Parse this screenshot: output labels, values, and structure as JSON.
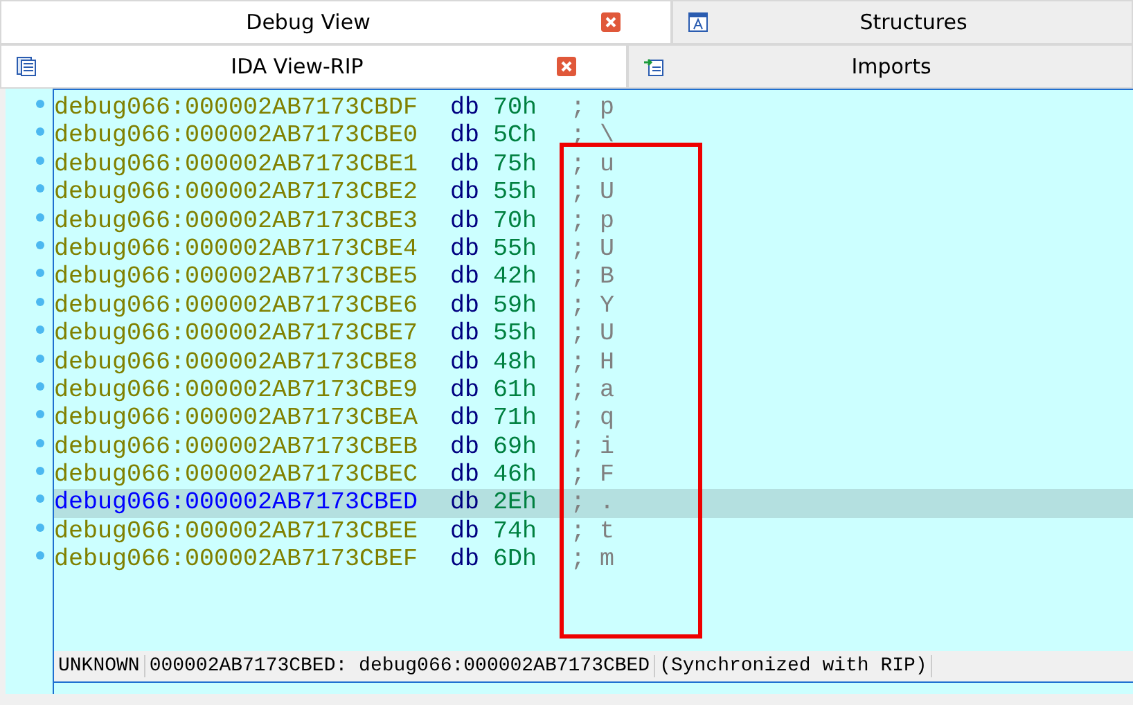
{
  "tab_rows": [
    {
      "tabs": [
        {
          "label": "Debug View",
          "selected": true,
          "closable": true
        },
        {
          "label": "Structures",
          "selected": false,
          "closable": false
        }
      ]
    },
    {
      "tabs": [
        {
          "label": "IDA View-RIP",
          "selected": true,
          "closable": true
        },
        {
          "label": "Imports",
          "selected": false,
          "closable": false
        }
      ]
    }
  ],
  "listing": [
    {
      "address": "debug066:000002AB7173CBDF",
      "directive": "db",
      "value": "70h",
      "comment": "; p",
      "selected": false
    },
    {
      "address": "debug066:000002AB7173CBE0",
      "directive": "db",
      "value": "5Ch",
      "comment": "; \\",
      "selected": false
    },
    {
      "address": "debug066:000002AB7173CBE1",
      "directive": "db",
      "value": "75h",
      "comment": "; u",
      "selected": false
    },
    {
      "address": "debug066:000002AB7173CBE2",
      "directive": "db",
      "value": "55h",
      "comment": "; U",
      "selected": false
    },
    {
      "address": "debug066:000002AB7173CBE3",
      "directive": "db",
      "value": "70h",
      "comment": "; p",
      "selected": false
    },
    {
      "address": "debug066:000002AB7173CBE4",
      "directive": "db",
      "value": "55h",
      "comment": "; U",
      "selected": false
    },
    {
      "address": "debug066:000002AB7173CBE5",
      "directive": "db",
      "value": "42h",
      "comment": "; B",
      "selected": false
    },
    {
      "address": "debug066:000002AB7173CBE6",
      "directive": "db",
      "value": "59h",
      "comment": "; Y",
      "selected": false
    },
    {
      "address": "debug066:000002AB7173CBE7",
      "directive": "db",
      "value": "55h",
      "comment": "; U",
      "selected": false
    },
    {
      "address": "debug066:000002AB7173CBE8",
      "directive": "db",
      "value": "48h",
      "comment": "; H",
      "selected": false
    },
    {
      "address": "debug066:000002AB7173CBE9",
      "directive": "db",
      "value": "61h",
      "comment": "; a",
      "selected": false
    },
    {
      "address": "debug066:000002AB7173CBEA",
      "directive": "db",
      "value": "71h",
      "comment": "; q",
      "selected": false
    },
    {
      "address": "debug066:000002AB7173CBEB",
      "directive": "db",
      "value": "69h",
      "comment": "; i",
      "selected": false
    },
    {
      "address": "debug066:000002AB7173CBEC",
      "directive": "db",
      "value": "46h",
      "comment": "; F",
      "selected": false
    },
    {
      "address": "debug066:000002AB7173CBED",
      "directive": "db",
      "value": "2Eh",
      "comment": "; .",
      "selected": true
    },
    {
      "address": "debug066:000002AB7173CBEE",
      "directive": "db",
      "value": "74h",
      "comment": "; t",
      "selected": false
    },
    {
      "address": "debug066:000002AB7173CBEF",
      "directive": "db",
      "value": "6Dh",
      "comment": "; m",
      "selected": false
    }
  ],
  "status_bar": [
    "UNKNOWN",
    "000002AB7173CBED: debug066:000002AB7173CBED",
    "(Synchronized with RIP)"
  ]
}
